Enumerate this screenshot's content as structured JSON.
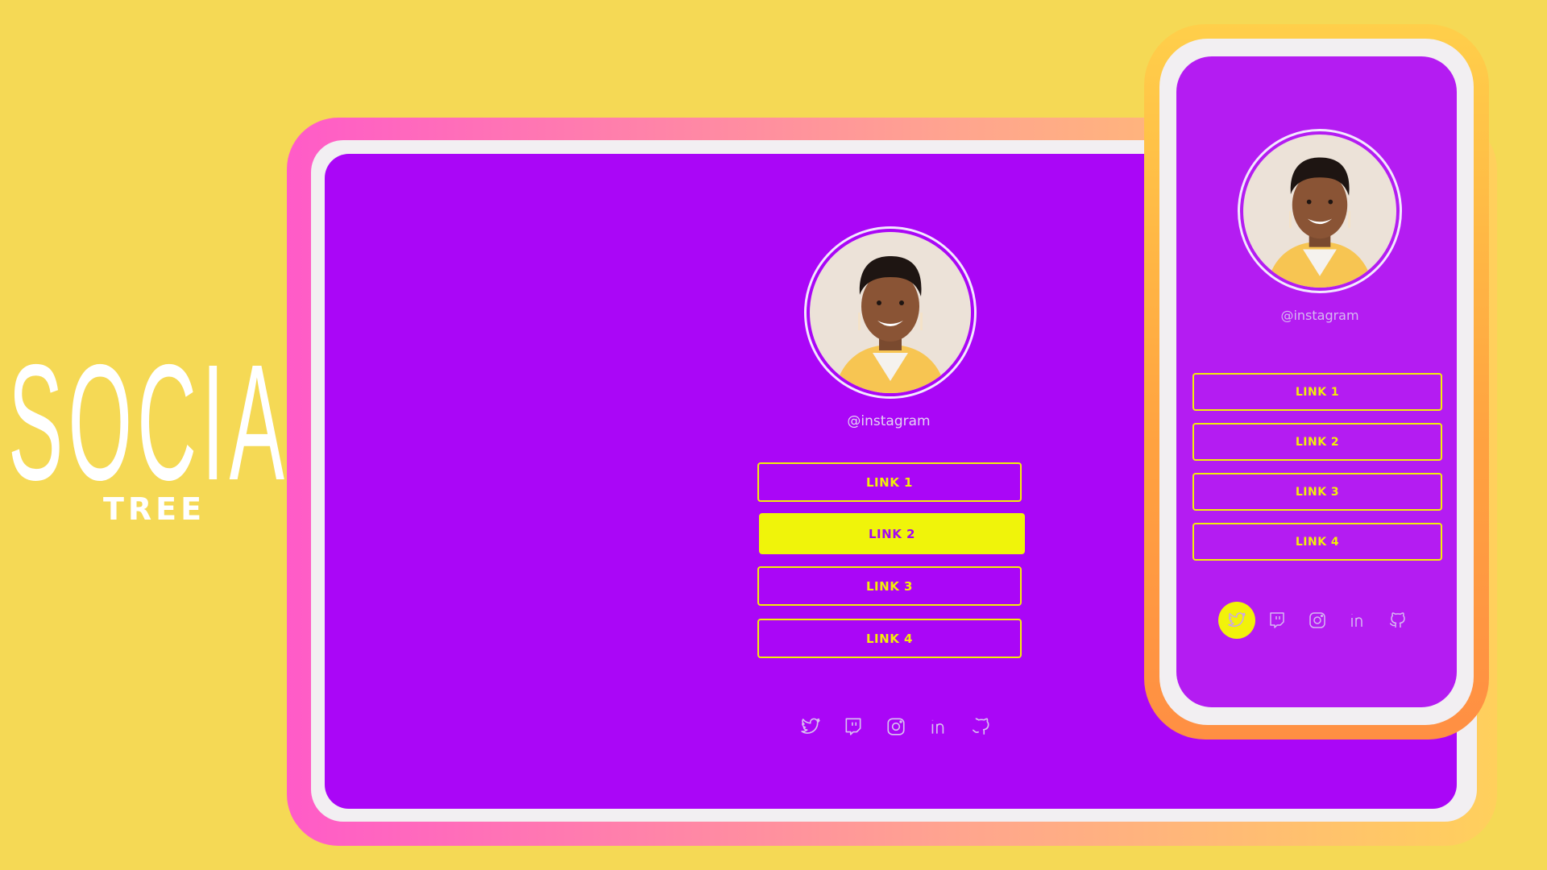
{
  "brand": {
    "title": "SOCIAL",
    "subtitle": "TREE"
  },
  "colors": {
    "background": "#f5d955",
    "screen": "#aa06f7",
    "accent": "#f2ef08"
  },
  "profile": {
    "handle": "@instagram"
  },
  "desktop": {
    "links": [
      {
        "label": "LINK 1",
        "active": false
      },
      {
        "label": "LINK 2",
        "active": true
      },
      {
        "label": "LINK 3",
        "active": false
      },
      {
        "label": "LINK 4",
        "active": false
      }
    ],
    "social_icons": [
      "twitter-icon",
      "twitch-icon",
      "instagram-icon",
      "linkedin-icon",
      "github-icon"
    ]
  },
  "mobile": {
    "links": [
      {
        "label": "LINK 1",
        "active": false
      },
      {
        "label": "LINK 2",
        "active": false
      },
      {
        "label": "LINK 3",
        "active": false
      },
      {
        "label": "LINK 4",
        "active": false
      }
    ],
    "social_icons": [
      "twitter-icon",
      "twitch-icon",
      "instagram-icon",
      "linkedin-icon",
      "github-icon"
    ],
    "active_icon": "twitter-icon"
  }
}
